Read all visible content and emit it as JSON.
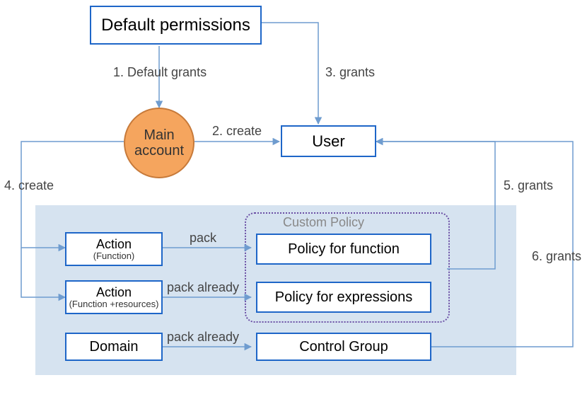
{
  "nodes": {
    "default_permissions": "Default permissions",
    "main_account_l1": "Main",
    "main_account_l2": "account",
    "user": "User",
    "action_fn_title": "Action",
    "action_fn_sub": "(Function)",
    "action_fr_title": "Action",
    "action_fr_sub": "(Function +resources)",
    "domain": "Domain",
    "policy_fn": "Policy for function",
    "policy_expr": "Policy for expressions",
    "control_group": "Control Group",
    "custom_policy": "Custom Policy"
  },
  "edges": {
    "e1": "1. Default grants",
    "e2": "2. create",
    "e3": "3. grants",
    "e4": "4. create",
    "e5": "5. grants",
    "e6": "6. grants",
    "pack": "pack",
    "pack_already_1": "pack already",
    "pack_already_2": "pack already"
  }
}
